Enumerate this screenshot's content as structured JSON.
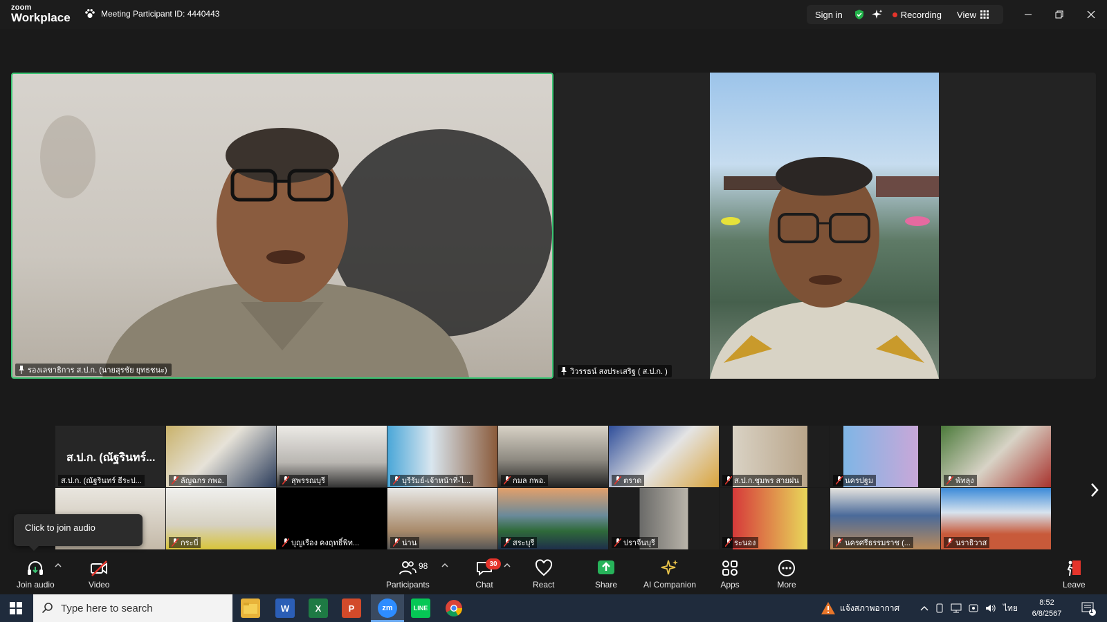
{
  "titlebar": {
    "logo_small": "zoom",
    "logo_big": "Workplace",
    "meeting_id": "Meeting Participant ID: 4440443",
    "sign_in": "Sign in",
    "recording": "Recording",
    "view": "View"
  },
  "videos": {
    "main_name": "รองเลขาธิการ ส.ป.ก. (นายสุรชัย ยุทธชนะ)",
    "second_name": "วิวรรธน์ สงประเสริฐ ( ส.ป.ก. )"
  },
  "gallery": [
    {
      "name": "ส.ป.ก. (ณัฐรินทร์ ธีระป...",
      "big": "ส.ป.ก. (ณัฐรินทร์...",
      "muted": false
    },
    {
      "name": "ลัญฉกร กพอ.",
      "muted": true
    },
    {
      "name": "สุพรรณบุรี",
      "muted": true
    },
    {
      "name": "บุรีรัมย์-เจ้าหน้าที่-ไ...",
      "muted": true
    },
    {
      "name": "กมล กพอ.",
      "muted": true
    },
    {
      "name": "ตราด",
      "muted": true
    },
    {
      "name": "ส.ป.ก.ชุมพร สายฝน",
      "muted": true
    },
    {
      "name": "นครปฐม",
      "muted": true
    },
    {
      "name": "พัทลุง",
      "muted": true
    },
    {
      "name": "",
      "muted": false
    },
    {
      "name": "กระบี่",
      "muted": true
    },
    {
      "name": "บุญเรือง คงฤทธิ์พิท...",
      "muted": true
    },
    {
      "name": "น่าน",
      "muted": true
    },
    {
      "name": "สระบุรี",
      "muted": true
    },
    {
      "name": "ปราจีนบุรี",
      "muted": true
    },
    {
      "name": "ระนอง",
      "muted": true
    },
    {
      "name": "นครศรีธรรมราช (...",
      "muted": true
    },
    {
      "name": "นราธิวาส",
      "muted": true
    }
  ],
  "tooltip": "Click to join audio",
  "toolbar": {
    "join_audio": "Join audio",
    "video": "Video",
    "participants": "Participants",
    "participants_count": "98",
    "chat": "Chat",
    "chat_badge": "30",
    "react": "React",
    "share": "Share",
    "ai_companion": "AI Companion",
    "apps": "Apps",
    "more": "More",
    "leave": "Leave"
  },
  "taskbar": {
    "search_placeholder": "Type here to search",
    "weather": "แจ้งสภาพอากาศ",
    "lang": "ไทย",
    "time": "8:52",
    "date": "6/8/2567",
    "notif_count": "1"
  },
  "colors": {
    "active_speaker": "#3cc574",
    "share_green": "#27b35a",
    "badge_red": "#e5342b",
    "taskbar": "#1f2b3c"
  }
}
